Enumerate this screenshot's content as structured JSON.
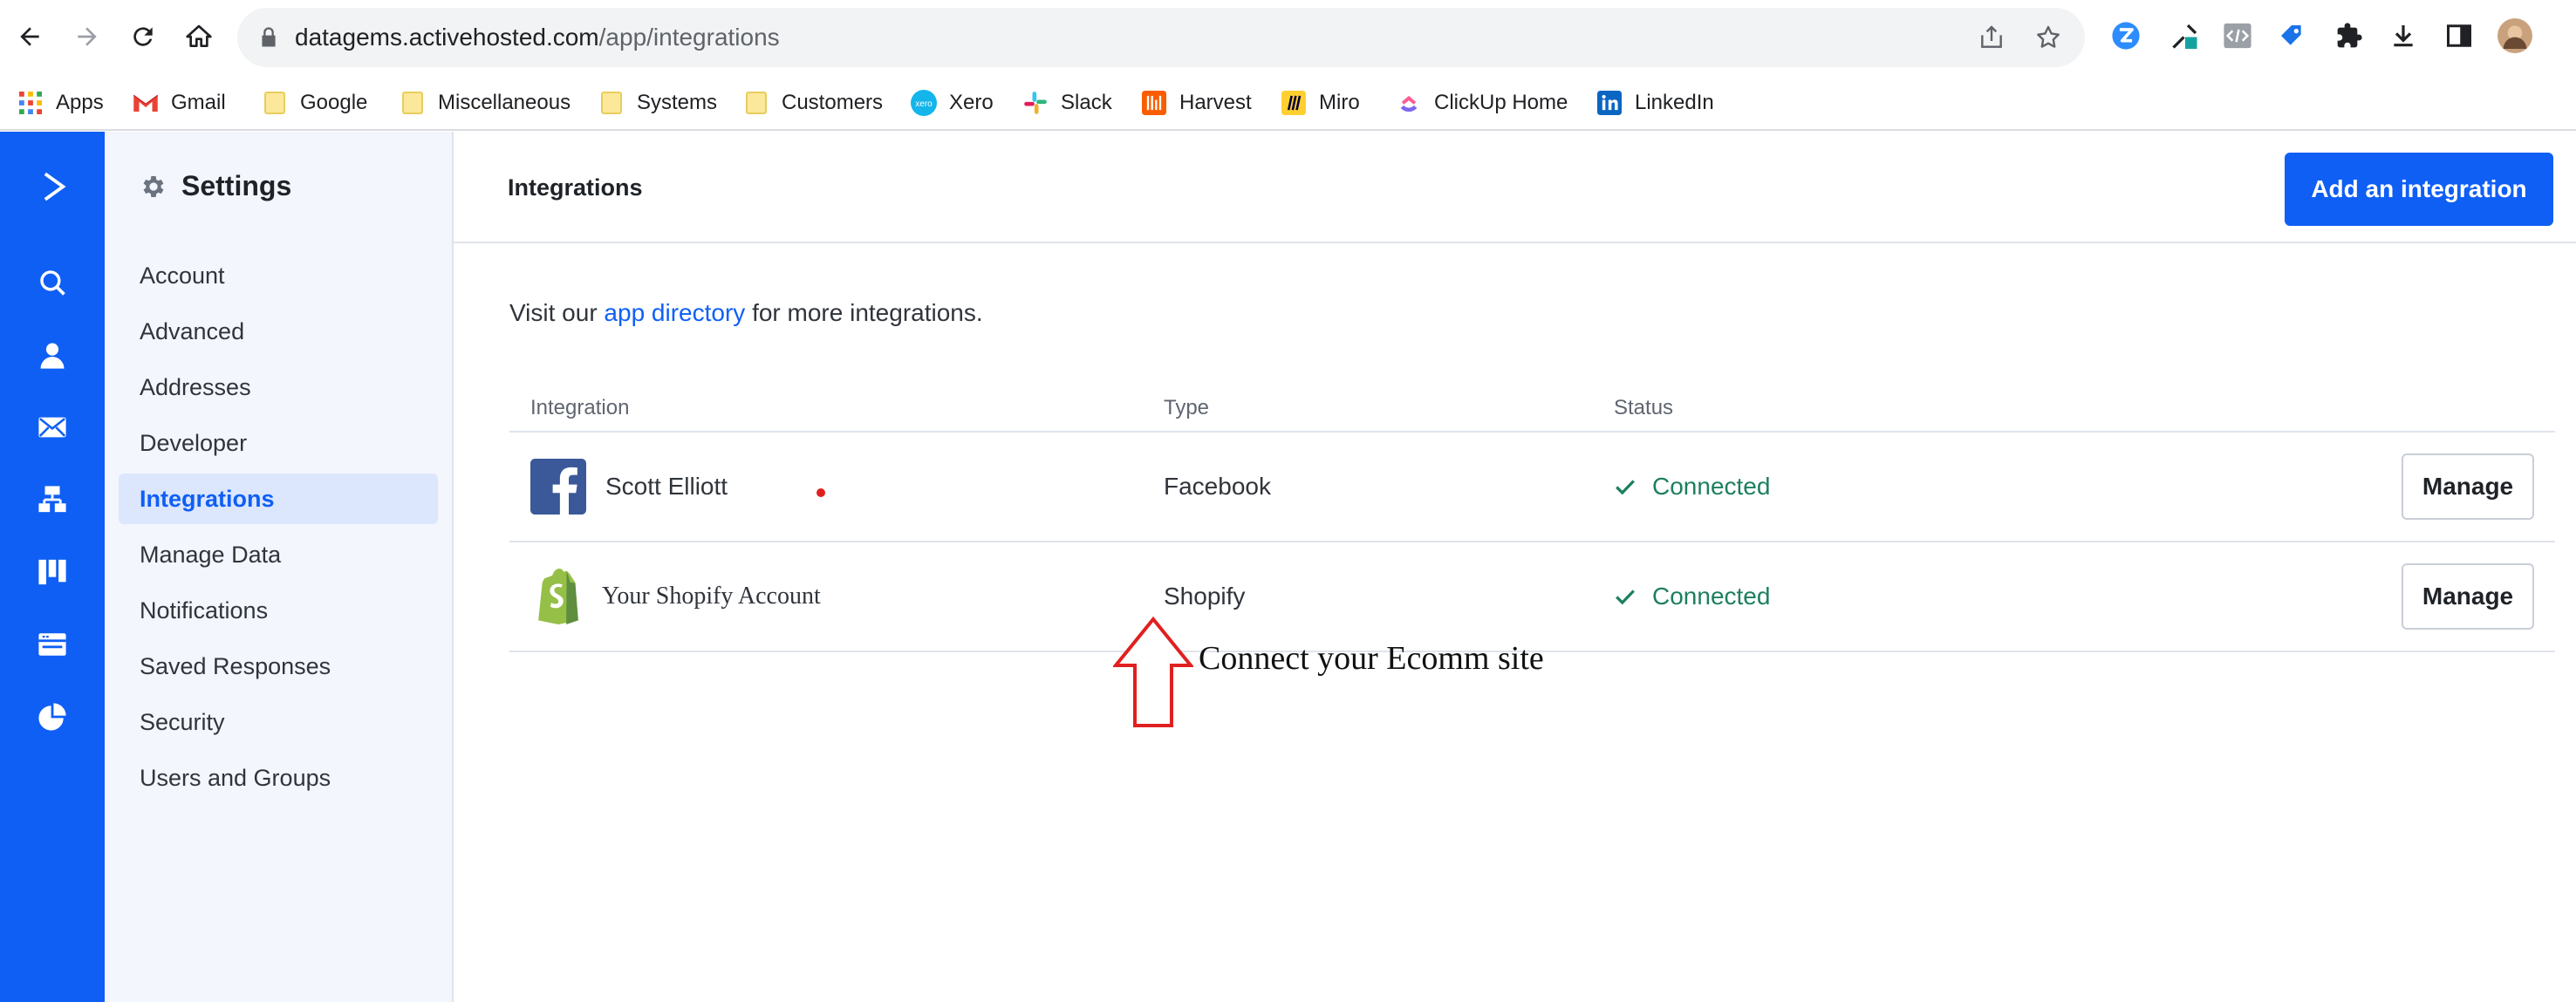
{
  "browser": {
    "url_host": "datagems.activehosted.com",
    "url_path": "/app/integrations",
    "bookmarks": [
      {
        "label": "Apps",
        "icon": "apps-grid-icon"
      },
      {
        "label": "Gmail",
        "icon": "gmail-icon"
      },
      {
        "label": "Google",
        "icon": "folder-icon"
      },
      {
        "label": "Miscellaneous",
        "icon": "folder-icon"
      },
      {
        "label": "Systems",
        "icon": "folder-icon"
      },
      {
        "label": "Customers",
        "icon": "folder-icon"
      },
      {
        "label": "Xero",
        "icon": "xero-icon"
      },
      {
        "label": "Slack",
        "icon": "slack-icon"
      },
      {
        "label": "Harvest",
        "icon": "harvest-icon"
      },
      {
        "label": "Miro",
        "icon": "miro-icon"
      },
      {
        "label": "ClickUp Home",
        "icon": "clickup-icon"
      },
      {
        "label": "LinkedIn",
        "icon": "linkedin-icon"
      }
    ],
    "xero_badge": "xero",
    "gmail_badge": "M"
  },
  "settings": {
    "title": "Settings",
    "items": [
      {
        "label": "Account"
      },
      {
        "label": "Advanced"
      },
      {
        "label": "Addresses"
      },
      {
        "label": "Developer"
      },
      {
        "label": "Integrations",
        "active": true
      },
      {
        "label": "Manage Data"
      },
      {
        "label": "Notifications"
      },
      {
        "label": "Saved Responses"
      },
      {
        "label": "Security"
      },
      {
        "label": "Users and Groups"
      }
    ]
  },
  "main": {
    "title": "Integrations",
    "add_button": "Add an integration",
    "intro_prefix": "Visit our ",
    "intro_link": "app directory",
    "intro_suffix": " for more integrations.",
    "columns": {
      "integration": "Integration",
      "type": "Type",
      "status": "Status"
    },
    "rows": [
      {
        "name": "Scott Elliott",
        "type": "Facebook",
        "status": "Connected",
        "action": "Manage",
        "logo": "facebook-logo-icon"
      },
      {
        "name": "Your Shopify Account",
        "type": "Shopify",
        "status": "Connected",
        "action": "Manage",
        "logo": "shopify-logo-icon"
      }
    ],
    "annotation": "Connect your Ecomm site"
  },
  "colors": {
    "brand_blue": "#0f5ff5",
    "connected_green": "#1c7f5f",
    "annotation_red": "#e02020"
  }
}
